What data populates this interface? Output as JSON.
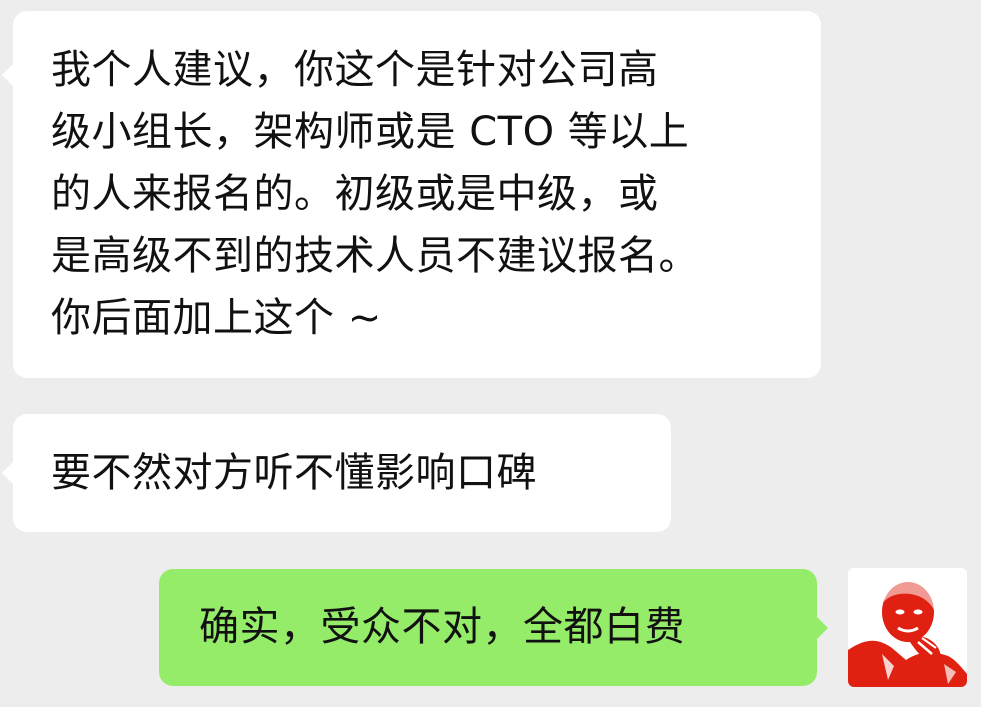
{
  "chat": {
    "messages": [
      {
        "sender": "other",
        "text": "我个人建议，你这个是针对公司高\n级小组长，架构师或是 CTO 等以上\n的人来报名的。初级或是中级，或\n是高级不到的技术人员不建议报名。\n你后面加上这个 ~"
      },
      {
        "sender": "other",
        "text": "要不然对方听不懂影响口碑"
      },
      {
        "sender": "self",
        "text": "确实，受众不对，全都白费"
      }
    ],
    "colors": {
      "background": "#ededed",
      "incoming_bubble": "#ffffff",
      "outgoing_bubble": "#95ec69",
      "avatar_accent": "#e02010"
    }
  }
}
